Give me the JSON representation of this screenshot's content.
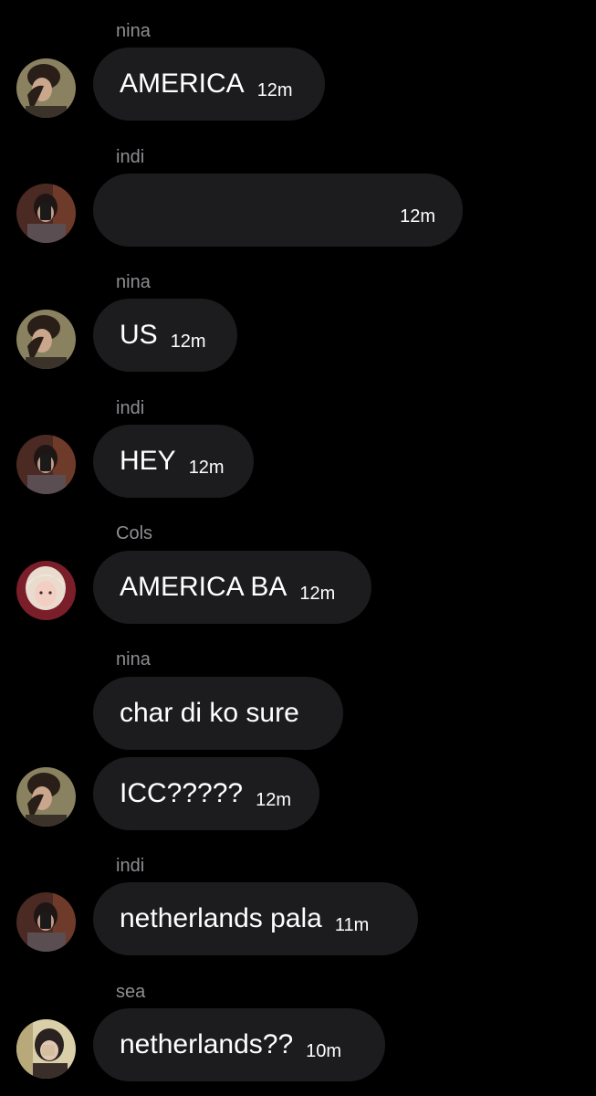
{
  "messages": [
    {
      "sender": "nina",
      "text": "AMERICA",
      "time": "12m",
      "avatar": "nina-avatar"
    },
    {
      "sender": "indi",
      "text": "",
      "time": "12m",
      "avatar": "indi-avatar"
    },
    {
      "sender": "nina",
      "text": "US",
      "time": "12m",
      "avatar": "nina-avatar"
    },
    {
      "sender": "indi",
      "text": "HEY",
      "time": "12m",
      "avatar": "indi-avatar"
    },
    {
      "sender": "Cols",
      "text": "AMERICA BA",
      "time": "12m",
      "avatar": "cols-avatar"
    },
    {
      "sender": "nina",
      "text": "char di ko sure",
      "time": "",
      "avatar": ""
    },
    {
      "sender": "",
      "text": "ICC?????",
      "time": "12m",
      "avatar": "nina-avatar"
    },
    {
      "sender": "indi",
      "text": "netherlands pala",
      "time": "11m",
      "avatar": "indi-avatar"
    },
    {
      "sender": "sea",
      "text": "netherlands??",
      "time": "10m",
      "avatar": "sea-avatar"
    }
  ],
  "colors": {
    "background": "#000000",
    "bubble": "#1c1c1e",
    "sender_label": "#8e8e93"
  }
}
